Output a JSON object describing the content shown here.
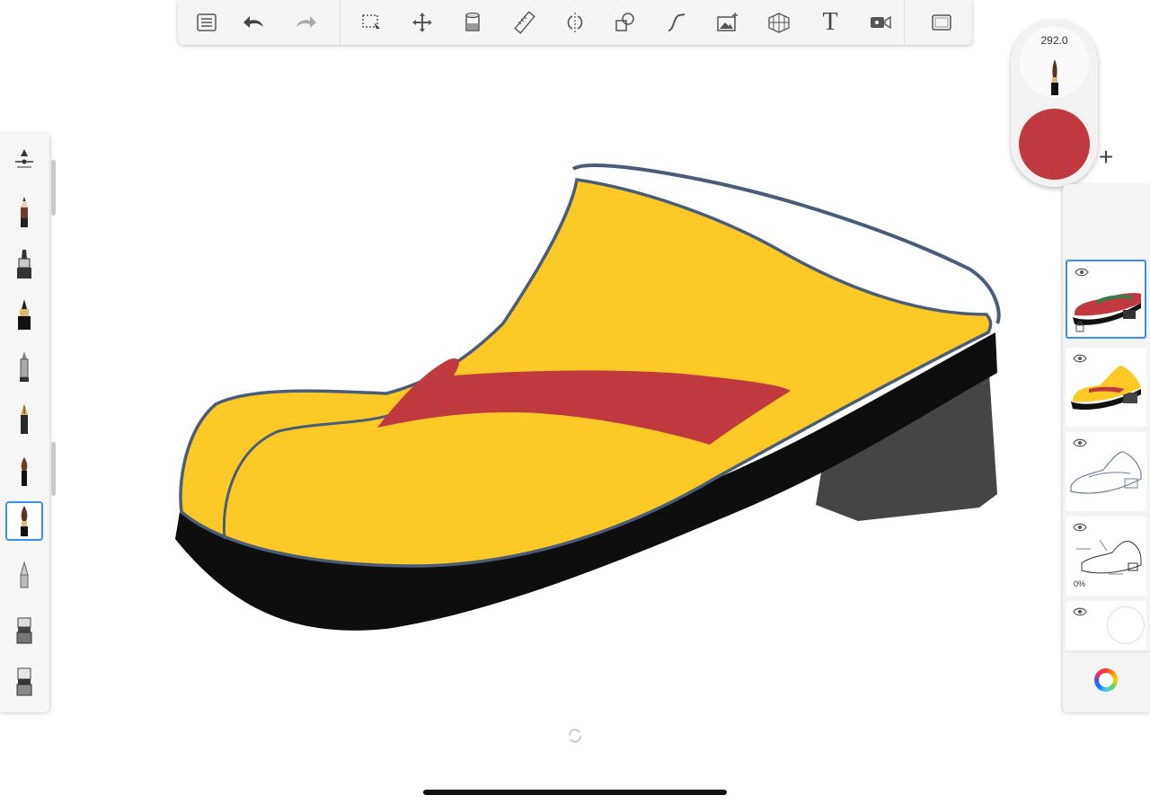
{
  "toolbar": {
    "items": [
      {
        "name": "gallery-list-icon"
      },
      {
        "name": "undo-icon"
      },
      {
        "name": "redo-icon"
      },
      {
        "name": "selection-icon"
      },
      {
        "name": "transform-icon"
      },
      {
        "name": "fill-bucket-icon"
      },
      {
        "name": "ruler-icon"
      },
      {
        "name": "symmetry-icon"
      },
      {
        "name": "shapes-icon"
      },
      {
        "name": "curve-icon"
      },
      {
        "name": "import-image-icon"
      },
      {
        "name": "perspective-grid-icon"
      },
      {
        "name": "text-icon",
        "label": "T"
      },
      {
        "name": "timelapse-record-icon"
      },
      {
        "name": "fullscreen-icon"
      }
    ]
  },
  "brushes": [
    {
      "name": "brush-properties-icon"
    },
    {
      "name": "pencil-brush-icon"
    },
    {
      "name": "marker-brush-icon"
    },
    {
      "name": "ink-pen-brush-icon"
    },
    {
      "name": "airbrush-icon"
    },
    {
      "name": "fountain-pen-brush-icon"
    },
    {
      "name": "paint-brush-icon"
    },
    {
      "name": "paint-brush-selected-icon",
      "selected": true
    },
    {
      "name": "soft-eraser-icon"
    },
    {
      "name": "smudge-tool-icon"
    },
    {
      "name": "hard-eraser-icon"
    }
  ],
  "puck": {
    "brush_size": "292.0",
    "color": "#c0393f"
  },
  "layers": {
    "add_label": "+",
    "items": [
      {
        "name": "layer-strap",
        "selected": true,
        "opacity": ""
      },
      {
        "name": "layer-sole-color",
        "selected": false,
        "opacity": ""
      },
      {
        "name": "layer-line-sketch",
        "selected": false,
        "opacity": ""
      },
      {
        "name": "layer-reference",
        "selected": false,
        "opacity": "0%"
      },
      {
        "name": "layer-background",
        "selected": false,
        "opacity": ""
      }
    ]
  },
  "colors": {
    "yellow": "#fdc927",
    "red": "#c0393f",
    "outline": "#4a5d78",
    "sole_black": "#0e0e0e",
    "heel_gray": "#454545",
    "accent": "#3b8ef0"
  }
}
